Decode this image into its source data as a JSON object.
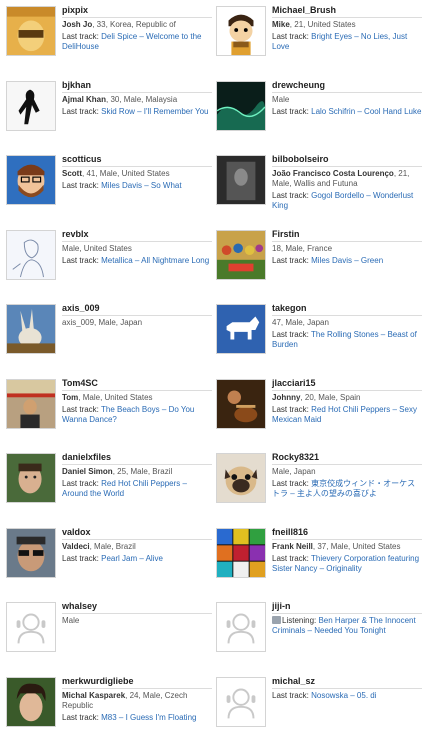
{
  "last_track_label": "Last track: ",
  "listening_label": "Listening: ",
  "users": [
    {
      "username": "pixpix",
      "realname": "Josh Jo",
      "details": ", 33, Korea, Republic of",
      "track": "Deli Spice – Welcome to the DeliHouse",
      "avatar": "yellow-hood"
    },
    {
      "username": "Michael_Brush",
      "realname": "Mike",
      "details": ", 21, United States",
      "track": "Bright Eyes – No Lies, Just Love",
      "avatar": "cartoon-boy"
    },
    {
      "username": "bjkhan",
      "realname": "Ajmal Khan",
      "details": ", 30, Male, Malaysia",
      "track": "Skid Row – I'll Remember You",
      "avatar": "silhouette"
    },
    {
      "username": "drewcheung",
      "realname": "",
      "details": "Male",
      "track": "Lalo Schifrin – Cool Hand Luke",
      "avatar": "green-wave"
    },
    {
      "username": "scotticus",
      "realname": "Scott",
      "details": ", 41, Male, United States",
      "track": "Miles Davis – So What",
      "avatar": "cartoon-beard"
    },
    {
      "username": "bilbobolseiro",
      "realname": "João Francisco Costa Lourenço",
      "details": ", 21, Male, Wallis and Futuna",
      "track": "Gogol Bordello – Wonderlust King",
      "avatar": "dark-photo"
    },
    {
      "username": "revblx",
      "realname": "",
      "details": "Male, United States",
      "track": "Metallica – All Nightmare Long",
      "avatar": "sketch"
    },
    {
      "username": "Firstin",
      "realname": "",
      "details": "18, Male, France",
      "track": "Miles Davis – Green",
      "avatar": "beatles"
    },
    {
      "username": "axis_009",
      "realname": "",
      "details": "axis_009, Male, Japan",
      "track": "",
      "avatar": "rabbit"
    },
    {
      "username": "takegon",
      "realname": "",
      "details": "47, Male, Japan",
      "track": "The Rolling Stones – Beast of Burden",
      "avatar": "dog-icon"
    },
    {
      "username": "Tom4SC",
      "realname": "Tom",
      "details": ", Male, United States",
      "track": "The Beach Boys – Do You Wanna Dance?",
      "avatar": "street-photo"
    },
    {
      "username": "jlacciari15",
      "realname": "Johnny",
      "details": ", 20, Male, Spain",
      "track": "Red Hot Chili Peppers – Sexy Mexican Maid",
      "avatar": "guitar"
    },
    {
      "username": "danielxfiles",
      "realname": "Daniel Simon",
      "details": ", 25, Male, Brazil",
      "track": "Red Hot Chili Peppers – Around the World",
      "avatar": "face-green"
    },
    {
      "username": "Rocky8321",
      "realname": "",
      "details": "Male, Japan",
      "track": "東京佼成ウィンド・オーケストラ – 主よ人の望みの喜びよ",
      "avatar": "pug"
    },
    {
      "username": "valdox",
      "realname": "Valdeci",
      "details": ", Male, Brazil",
      "track": "Pearl Jam – Alive",
      "avatar": "sunglasses"
    },
    {
      "username": "fneill816",
      "realname": "Frank Neill",
      "details": ", 37, Male, United States",
      "track": "Thievery Corporation featuring Sister Nancy – Originality",
      "avatar": "colorgrid"
    },
    {
      "username": "whalsey",
      "realname": "",
      "details": "Male",
      "track": "",
      "avatar": "default"
    },
    {
      "username": "jiji-n",
      "realname": "",
      "details": "",
      "track": "Ben Harper & The Innocent Criminals – Needed You Tonight",
      "avatar": "default",
      "listening": true
    },
    {
      "username": "merkwurdigliebe",
      "realname": "Michal Kasparek",
      "details": ", 24, Male, Czech Republic",
      "track": "M83 – I Guess I'm Floating",
      "avatar": "hair-guy"
    },
    {
      "username": "michal_sz",
      "realname": "",
      "details": "",
      "track": "Nosowska – 05. di",
      "avatar": "default"
    }
  ]
}
